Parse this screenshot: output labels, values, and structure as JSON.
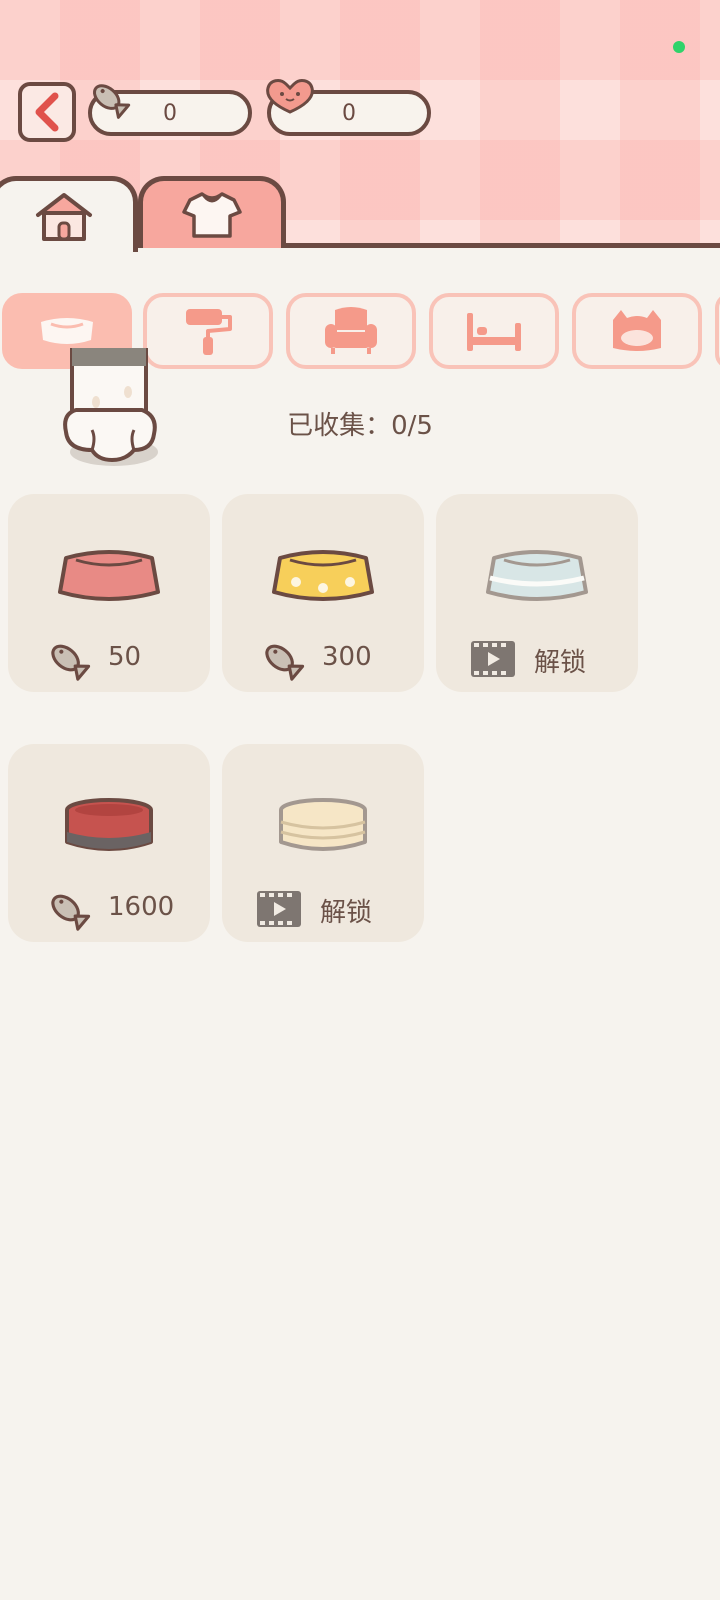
{
  "header": {
    "fish_count": "0",
    "heart_count": "0"
  },
  "tabs": [
    {
      "name": "home",
      "icon": "house-icon"
    },
    {
      "name": "clothes",
      "icon": "shirt-icon"
    }
  ],
  "categories": [
    {
      "icon": "food-bowl-icon",
      "active": true
    },
    {
      "icon": "paint-roller-icon",
      "active": false
    },
    {
      "icon": "armchair-icon",
      "active": false
    },
    {
      "icon": "bed-icon",
      "active": false
    },
    {
      "icon": "cat-bed-icon",
      "active": false
    }
  ],
  "collected_label": "已收集：0/5",
  "items": [
    {
      "bowl_color": "#e88a85",
      "price_type": "fish",
      "price": "50"
    },
    {
      "bowl_color": "#f7cf5a",
      "price_type": "fish",
      "price": "300"
    },
    {
      "bowl_color": "#d8e6e6",
      "price_type": "video",
      "label": "解锁"
    },
    {
      "bowl_color": "#c6534f",
      "price_type": "fish",
      "price": "1600"
    },
    {
      "bowl_color": "#f6e6c6",
      "price_type": "video",
      "label": "解锁"
    }
  ],
  "colors": {
    "outline": "#6b4a42",
    "accent": "#f7a79e",
    "background": "#f6f3ee"
  }
}
